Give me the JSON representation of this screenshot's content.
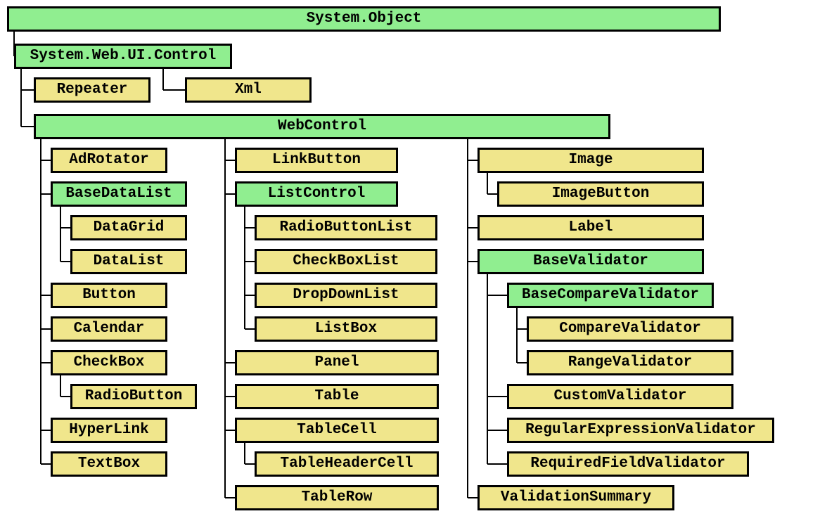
{
  "diagram": {
    "root": "System.Object",
    "control": "System.Web.UI.Control",
    "repeater": "Repeater",
    "xml": "Xml",
    "webcontrol": "WebControl",
    "col1": {
      "adrotator": "AdRotator",
      "basedatalist": "BaseDataList",
      "datagrid": "DataGrid",
      "datalist": "DataList",
      "button": "Button",
      "calendar": "Calendar",
      "checkbox": "CheckBox",
      "radiobutton": "RadioButton",
      "hyperlink": "HyperLink",
      "textbox": "TextBox"
    },
    "col2": {
      "linkbutton": "LinkButton",
      "listcontrol": "ListControl",
      "radiobuttonlist": "RadioButtonList",
      "checkboxlist": "CheckBoxList",
      "dropdownlist": "DropDownList",
      "listbox": "ListBox",
      "panel": "Panel",
      "table": "Table",
      "tablecell": "TableCell",
      "tableheadercell": "TableHeaderCell",
      "tablerow": "TableRow"
    },
    "col3": {
      "image": "Image",
      "imagebutton": "ImageButton",
      "label": "Label",
      "basevalidator": "BaseValidator",
      "basecomparevalidator": "BaseCompareValidator",
      "comparevalidator": "CompareValidator",
      "rangevalidator": "RangeValidator",
      "customvalidator": "CustomValidator",
      "regexvalidator": "RegularExpressionValidator",
      "requiredfieldvalidator": "RequiredFieldValidator",
      "validationsummary": "ValidationSummary"
    }
  },
  "colors": {
    "parent": "#90ee90",
    "leaf": "#f0e68c"
  }
}
